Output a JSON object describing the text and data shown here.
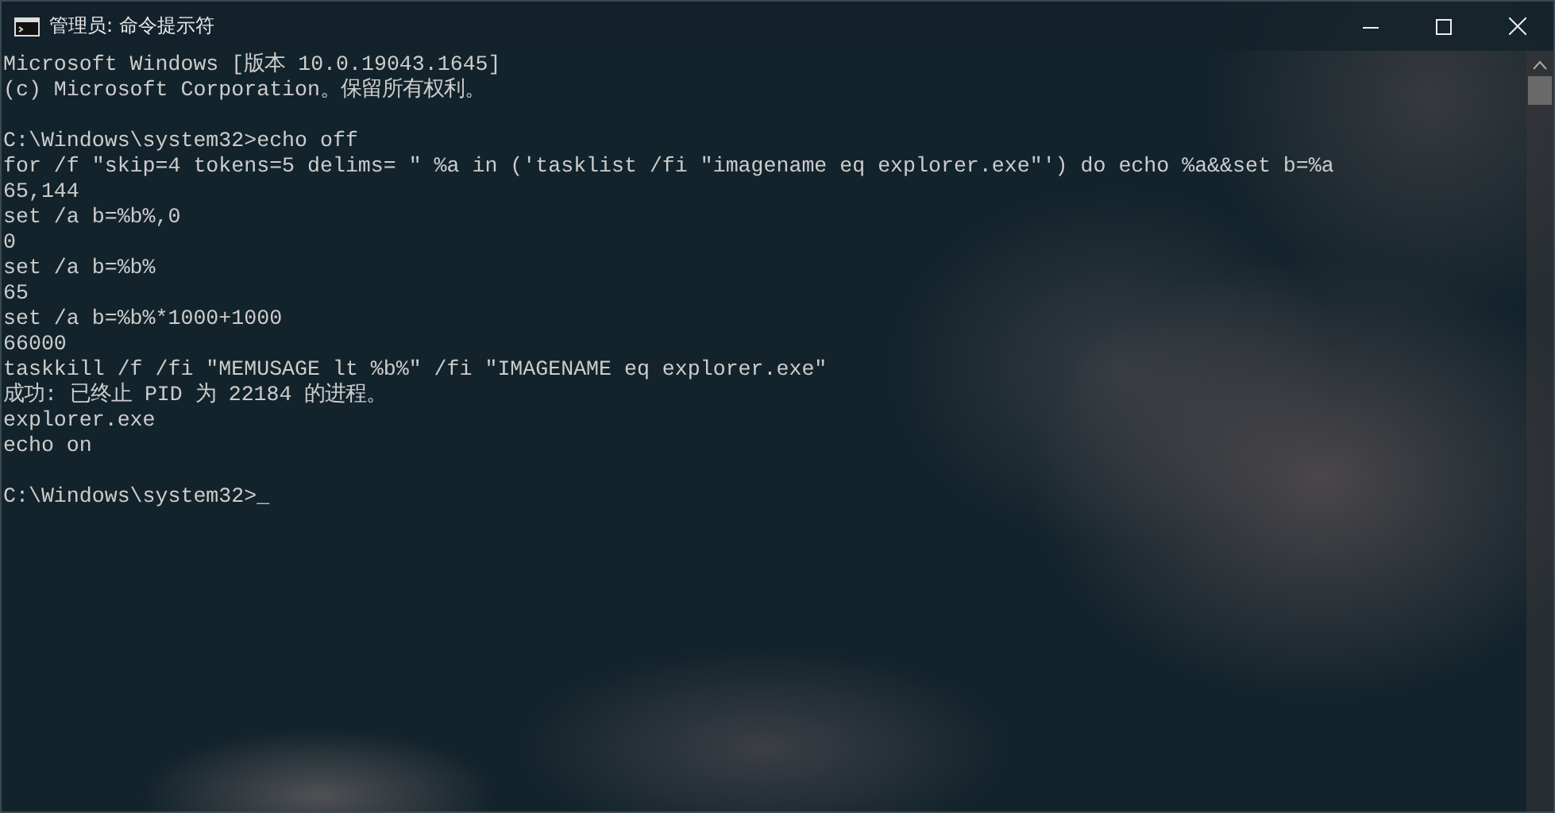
{
  "window": {
    "title": "管理员: 命令提示符"
  },
  "console": {
    "blocks": [
      [
        "Microsoft Windows [版本 10.0.19043.1645]",
        "(c) Microsoft Corporation。保留所有权利。"
      ],
      [
        "C:\\Windows\\system32>echo off",
        "for /f \"skip=4 tokens=5 delims= \" %a in ('tasklist /fi \"imagename eq explorer.exe\"') do echo %a&&set b=%a",
        "65,144",
        "set /a b=%b%,0",
        "0",
        "set /a b=%b%",
        "65",
        "set /a b=%b%*1000+1000",
        "66000",
        "taskkill /f /fi \"MEMUSAGE lt %b%\" /fi \"IMAGENAME eq explorer.exe\"",
        "成功: 已终止 PID 为 22184 的进程。",
        "explorer.exe",
        "echo on"
      ],
      [
        "C:\\Windows\\system32>_"
      ]
    ]
  }
}
